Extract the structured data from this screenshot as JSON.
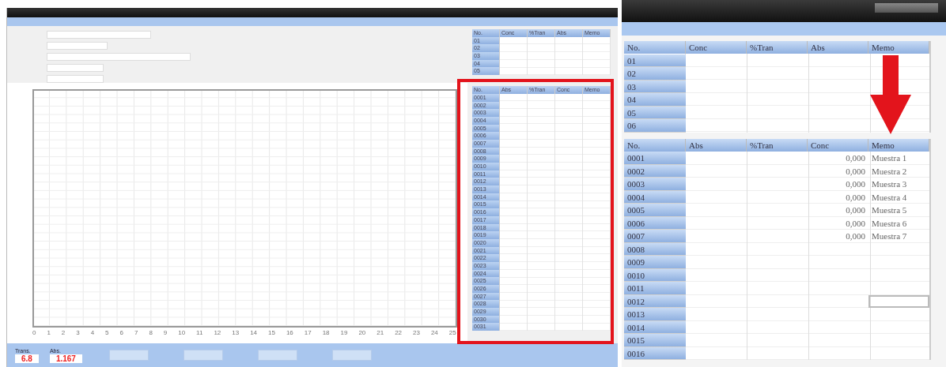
{
  "side_tables": {
    "top": {
      "columns": [
        "No.",
        "Conc",
        "%Tran",
        "Abs",
        "Memo"
      ],
      "rows": [
        "01",
        "02",
        "03",
        "04",
        "05"
      ]
    },
    "bottom": {
      "columns": [
        "No.",
        "Abs",
        "%Tran",
        "Conc",
        "Memo"
      ],
      "rows": [
        "0001",
        "0002",
        "0003",
        "0004",
        "0005",
        "0006",
        "0007",
        "0008",
        "0009",
        "0010",
        "0011",
        "0012",
        "0013",
        "0014",
        "0015",
        "0016",
        "0017",
        "0018",
        "0019",
        "0020",
        "0021",
        "0022",
        "0023",
        "0024",
        "0025",
        "0026",
        "0027",
        "0028",
        "0029",
        "0030",
        "0031"
      ]
    }
  },
  "chart": {
    "x_ticks": [
      "0",
      "1",
      "2",
      "3",
      "4",
      "5",
      "6",
      "7",
      "8",
      "9",
      "10",
      "11",
      "12",
      "13",
      "14",
      "15",
      "16",
      "17",
      "18",
      "19",
      "20",
      "21",
      "22",
      "23",
      "24",
      "25"
    ]
  },
  "readings": [
    {
      "label": "Trans.",
      "value": "6.8"
    },
    {
      "label": "Abs.",
      "value": "1.167"
    }
  ],
  "zoom_inset": {
    "standards": {
      "columns": [
        "No.",
        "Conc",
        "%Tran",
        "Abs",
        "Memo"
      ],
      "rows": [
        {
          "no": "01"
        },
        {
          "no": "02"
        },
        {
          "no": "03"
        },
        {
          "no": "04"
        },
        {
          "no": "05"
        },
        {
          "no": "06"
        }
      ]
    },
    "samples": {
      "columns": [
        "No.",
        "Abs",
        "%Tran",
        "Conc",
        "Memo"
      ],
      "rows": [
        {
          "no": "0001",
          "conc": "0,000",
          "memo": "Muestra 1",
          "selected": false
        },
        {
          "no": "0002",
          "conc": "0,000",
          "memo": "Muestra 2",
          "selected": false
        },
        {
          "no": "0003",
          "conc": "0,000",
          "memo": "Muestra 3",
          "selected": false
        },
        {
          "no": "0004",
          "conc": "0,000",
          "memo": "Muestra 4",
          "selected": false
        },
        {
          "no": "0005",
          "conc": "0,000",
          "memo": "Muestra 5",
          "selected": false
        },
        {
          "no": "0006",
          "conc": "0,000",
          "memo": "Muestra 6",
          "selected": false
        },
        {
          "no": "0007",
          "conc": "0,000",
          "memo": "Muestra 7",
          "selected": false
        },
        {
          "no": "0008",
          "selected": false
        },
        {
          "no": "0009",
          "selected": false
        },
        {
          "no": "0010",
          "selected": false
        },
        {
          "no": "0011",
          "selected": false
        },
        {
          "no": "0012",
          "selected": true
        },
        {
          "no": "0013",
          "selected": false
        },
        {
          "no": "0014",
          "selected": false
        },
        {
          "no": "0015",
          "selected": false
        },
        {
          "no": "0016",
          "selected": false
        }
      ]
    }
  }
}
